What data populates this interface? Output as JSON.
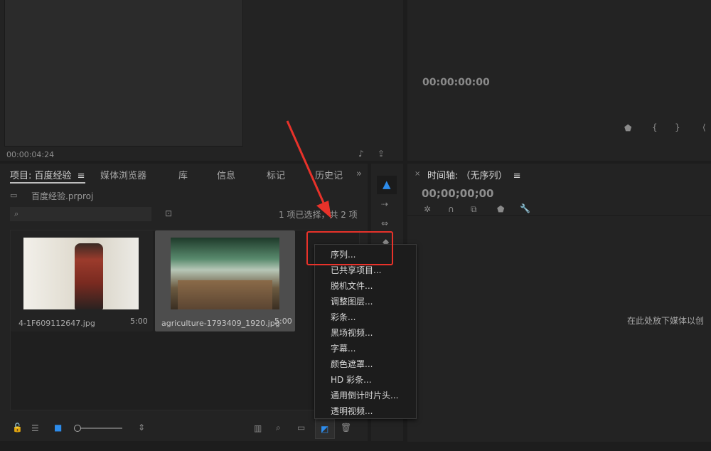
{
  "source_monitor": {
    "timecode": "00:00:04:24"
  },
  "program_monitor": {
    "timecode": "00:00:00:00"
  },
  "project_panel": {
    "tabs": [
      {
        "label": "项目: 百度经验",
        "active": true
      },
      {
        "label": "媒体浏览器"
      },
      {
        "label": "库"
      },
      {
        "label": "信息"
      },
      {
        "label": "标记"
      },
      {
        "label": "历史记"
      }
    ],
    "project_file": "百度经验.prproj",
    "selection_status": "1 项已选择，共 2 项",
    "items": [
      {
        "name": "4-1F609112647.jpg",
        "duration": "5:00"
      },
      {
        "name": "agriculture-1793409_1920.jpg",
        "duration": "5:00"
      }
    ]
  },
  "new_item_menu": {
    "items": [
      "序列...",
      "已共享项目...",
      "脱机文件...",
      "调整图层...",
      "彩条...",
      "黑场视频...",
      "字幕...",
      "颜色遮罩...",
      "HD 彩条...",
      "通用倒计时片头...",
      "透明视频..."
    ]
  },
  "timeline_panel": {
    "title": "时间轴: （无序列）",
    "timecode": "00;00;00;00",
    "drop_hint": "在此处放下媒体以创"
  },
  "colors": {
    "accent": "#2d8ceb",
    "annotation": "#e8322a"
  }
}
